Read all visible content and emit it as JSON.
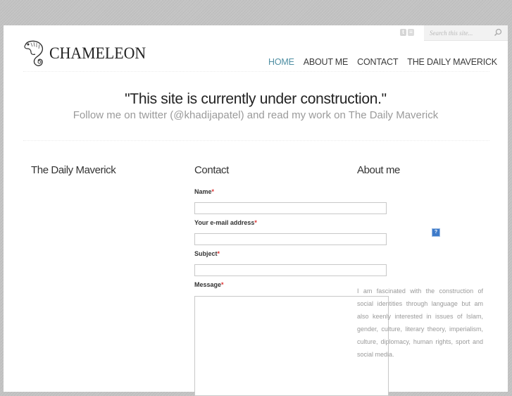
{
  "header": {
    "logo_text": "CHAMELEON",
    "search_placeholder": "Search this site...",
    "social": [
      {
        "name": "twitter",
        "glyph": "t"
      },
      {
        "name": "rss",
        "glyph": "≡"
      }
    ]
  },
  "nav": {
    "items": [
      {
        "label": "HOME",
        "active": true
      },
      {
        "label": "ABOUT ME",
        "active": false
      },
      {
        "label": "CONTACT",
        "active": false
      },
      {
        "label": "THE DAILY MAVERICK",
        "active": false
      }
    ],
    "active_color": "#4f8fa3"
  },
  "hero": {
    "title": "\"This site is currently under construction.\"",
    "subtitle": "Follow me on twitter (@khadijapatel) and read my work on The Daily Maverick"
  },
  "columns": {
    "daily_maverick": {
      "title": "The Daily Maverick"
    },
    "contact": {
      "title": "Contact",
      "fields": [
        {
          "label": "Name",
          "required_mark": "*",
          "value": ""
        },
        {
          "label": "Your e-mail address",
          "required_mark": "*",
          "value": ""
        },
        {
          "label": "Subject",
          "required_mark": "*",
          "value": ""
        },
        {
          "label": "Message",
          "required_mark": "*",
          "value": ""
        }
      ]
    },
    "about": {
      "title": "About me",
      "help_glyph": "?",
      "text": "I am fascinated with the construction of social identities through language but am also keenly interested in issues of Islam, gender, culture, literary theory, imperialism, culture, diplomacy, human rights, sport and social media."
    }
  }
}
